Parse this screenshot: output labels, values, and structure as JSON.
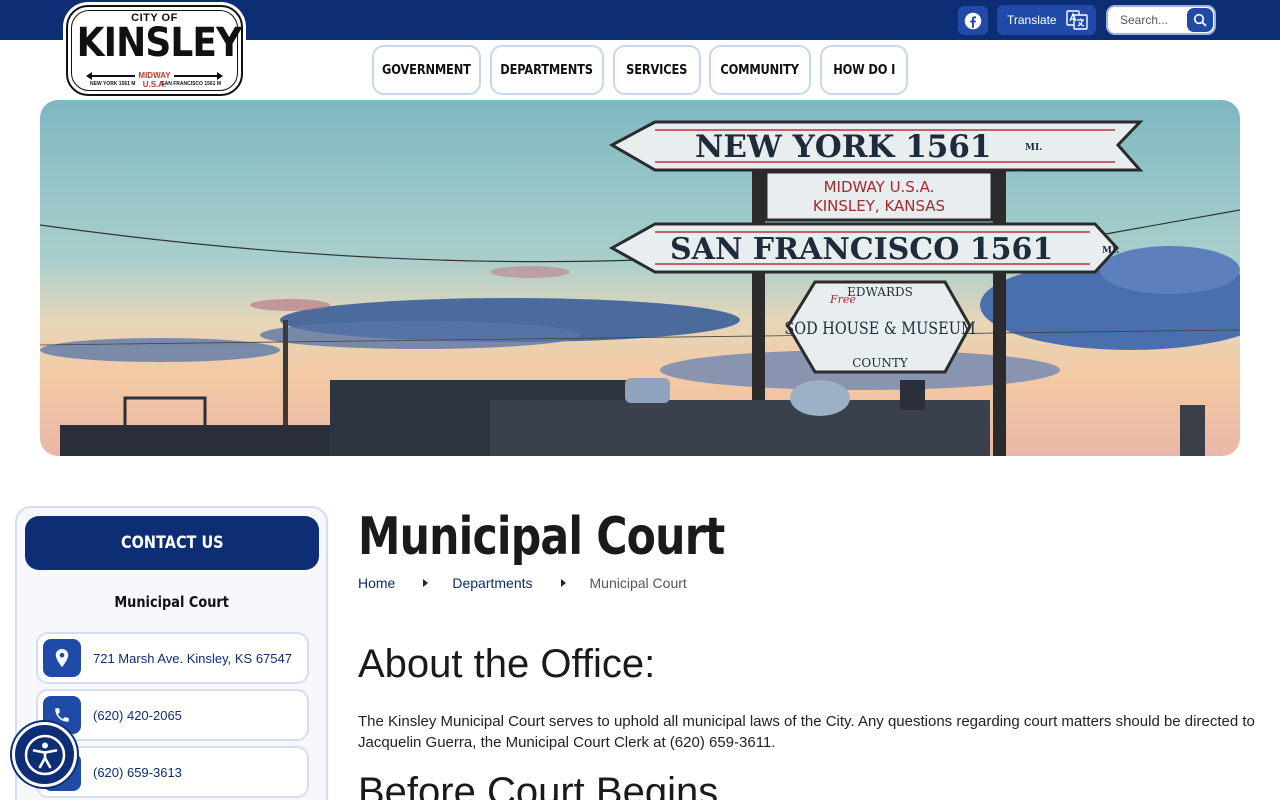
{
  "topbar": {
    "translate_label": "Translate",
    "search_placeholder": "Search..."
  },
  "logo": {
    "city_of": "CITY OF",
    "name": "KINSLEY",
    "midway": "MIDWAY",
    "usa": "U.S.A.",
    "new_york": "NEW YORK 1561 M",
    "san_francisco": "SAN FRANCISCO 1561 M"
  },
  "nav": {
    "items": [
      {
        "label": "GOVERNMENT"
      },
      {
        "label": "DEPARTMENTS"
      },
      {
        "label": "SERVICES"
      },
      {
        "label": "COMMUNITY"
      },
      {
        "label": "HOW DO I"
      }
    ]
  },
  "hero": {
    "sign_top": "NEW YORK 1561",
    "sign_top_unit": "MI.",
    "sign_mid_1": "MIDWAY U.S.A.",
    "sign_mid_2": "KINSLEY, KANSAS",
    "sign_bottom": "SAN FRANCISCO 1561",
    "sign_bottom_unit": "MI.",
    "museum_1": "EDWARDS",
    "museum_2": "SOD HOUSE & MUSEUM",
    "museum_3": "COUNTY",
    "museum_free": "Free"
  },
  "sidebar": {
    "contact_label": "CONTACT US",
    "department": "Municipal Court",
    "items": [
      {
        "text": "721 Marsh Ave. Kinsley, KS 67547",
        "icon": "location-pin-icon"
      },
      {
        "text": "(620) 420-2065",
        "icon": "phone-icon"
      },
      {
        "text": "(620) 659-3613",
        "icon": "fax-icon"
      }
    ]
  },
  "main": {
    "title": "Municipal Court",
    "breadcrumb": [
      "Home",
      "Departments",
      "Municipal Court"
    ],
    "about_heading": "About the Office:",
    "about_text": "The Kinsley Municipal Court serves to uphold all municipal laws of the City. Any questions regarding court matters should be directed to Jacquelin Guerra, the Municipal Court Clerk at (620) 659-3611.",
    "before_heading": "Before Court Begins"
  },
  "colors": {
    "navy": "#0d2d74",
    "blue": "#1f4aa8",
    "border": "#d4def0"
  }
}
